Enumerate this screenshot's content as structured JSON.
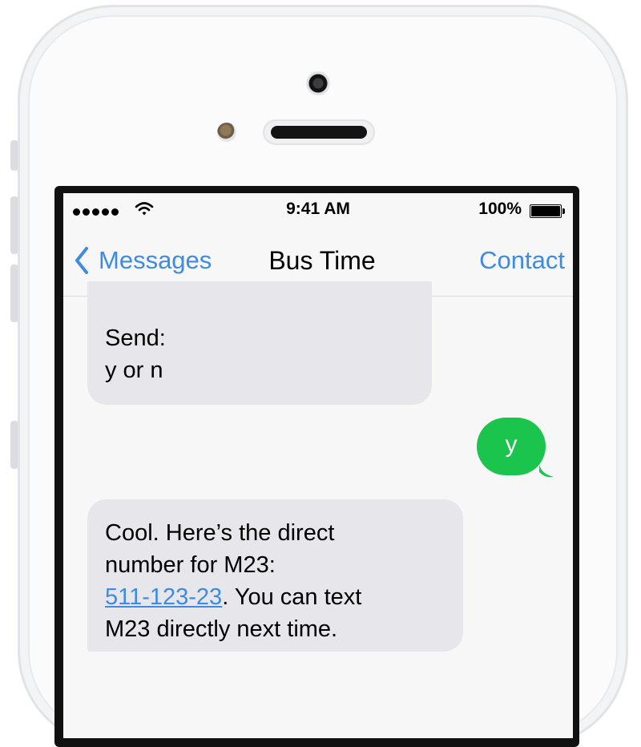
{
  "status_bar": {
    "time": "9:41 AM",
    "battery_percent": "100%",
    "signal_dots": 5,
    "signal_icon": "cellular-signal-icon",
    "wifi_icon": "wifi-icon",
    "battery_icon": "battery-icon"
  },
  "nav": {
    "back_label": "Messages",
    "back_icon": "chevron-left-icon",
    "title": "Bus Time",
    "contact_label": "Contact"
  },
  "messages": [
    {
      "sender": "incoming",
      "lines": [
        "Send:",
        "y or n"
      ]
    },
    {
      "sender": "outgoing",
      "text": "y"
    },
    {
      "sender": "incoming",
      "line1": "Cool. Here’s the direct",
      "line2": "number for M23:",
      "link": "511-123-23",
      "after_link": ". You can text",
      "line4": "M23 directly next time."
    }
  ],
  "colors": {
    "accent": "#3e8be0",
    "outgoing_bubble": "#1bc44d",
    "incoming_bubble": "#e6e6eb",
    "background": "#f7f7f8"
  }
}
